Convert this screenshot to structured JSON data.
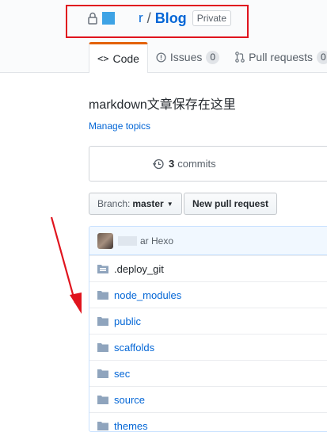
{
  "repo": {
    "owner": "r",
    "separator": "/",
    "name": "Blog",
    "visibility": "Private"
  },
  "tabs": [
    {
      "label": "Code",
      "icon": "code-icon"
    },
    {
      "label": "Issues",
      "count": "0",
      "icon": "issue-icon"
    },
    {
      "label": "Pull requests",
      "count": "0",
      "icon": "pull-request-icon"
    }
  ],
  "description": "markdown文章保存在这里",
  "manage_topics": "Manage topics",
  "summary": {
    "commits_count": "3",
    "commits_label": "commits"
  },
  "branch": {
    "prefix": "Branch:",
    "name": "master"
  },
  "new_pr_label": "New pull request",
  "commit_tease": {
    "author_suffix": "ar",
    "message": "Hexo"
  },
  "files": [
    {
      "name": ".deploy_git",
      "type": "submodule"
    },
    {
      "name": "node_modules",
      "type": "dir"
    },
    {
      "name": "public",
      "type": "dir"
    },
    {
      "name": "scaffolds",
      "type": "dir"
    },
    {
      "name": "sec",
      "type": "dir"
    },
    {
      "name": "source",
      "type": "dir"
    },
    {
      "name": "themes",
      "type": "dir"
    }
  ],
  "colors": {
    "link": "#0366d6",
    "annotation": "#e0141e",
    "tab_accent": "#e36209"
  }
}
